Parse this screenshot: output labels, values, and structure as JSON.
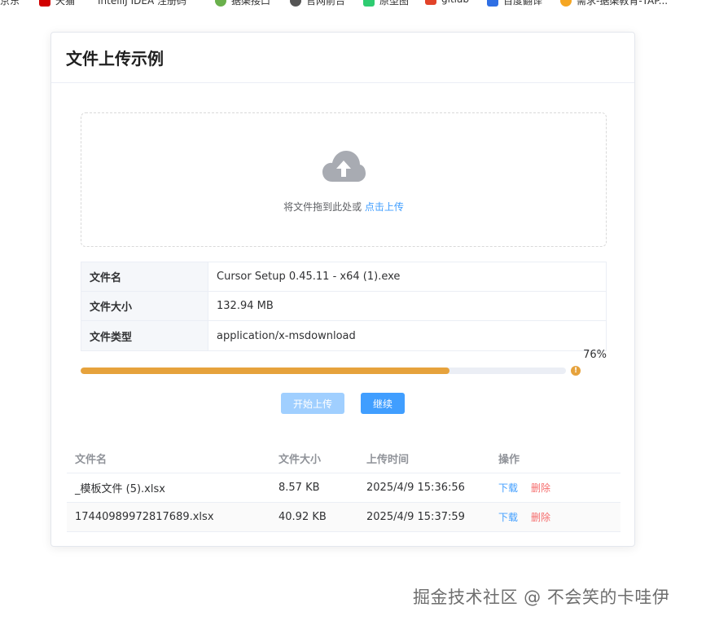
{
  "bookmarks": [
    {
      "label": "京东",
      "color": "#e1251b"
    },
    {
      "label": "天猫",
      "color": "#d10000"
    },
    {
      "label": "IntelliJ IDEA 注册码",
      "color": "#999999"
    },
    {
      "label": "据渠接口",
      "color": "#6ab04c"
    },
    {
      "label": "官网前台",
      "color": "#555555"
    },
    {
      "label": "原型图",
      "color": "#2ecc71"
    },
    {
      "label": "gitlab",
      "color": "#e24329"
    },
    {
      "label": "百度翻译",
      "color": "#2f6fe4"
    },
    {
      "label": "需求-据渠教育-TAP...",
      "color": "#f5a623"
    }
  ],
  "card": {
    "title": "文件上传示例"
  },
  "dropzone": {
    "icon": "cloud-upload-icon",
    "text": "将文件拖到此处或 ",
    "link": "点击上传"
  },
  "file_info": [
    {
      "key": "文件名",
      "value": "Cursor Setup 0.45.11 - x64 (1).exe"
    },
    {
      "key": "文件大小",
      "value": "132.94 MB"
    },
    {
      "key": "文件类型",
      "value": "application/x-msdownload"
    }
  ],
  "progress": {
    "percent_label": "76%",
    "fraction": 0.76,
    "color": "#e6a23c",
    "status_icon": "!"
  },
  "buttons": {
    "start_label": "开始上传",
    "continue_label": "继续"
  },
  "list": {
    "headers": {
      "name": "文件名",
      "size": "文件大小",
      "time": "上传时间",
      "action": "操作"
    },
    "rows": [
      {
        "name": "_模板文件 (5).xlsx",
        "size": "8.57 KB",
        "time": "2025/4/9 15:36:56",
        "download": "下载",
        "delete": "删除"
      },
      {
        "name": "17440989972817689.xlsx",
        "size": "40.92 KB",
        "time": "2025/4/9 15:37:59",
        "download": "下载",
        "delete": "删除"
      }
    ]
  },
  "watermark": "掘金技术社区 @ 不会笑的卡哇伊"
}
